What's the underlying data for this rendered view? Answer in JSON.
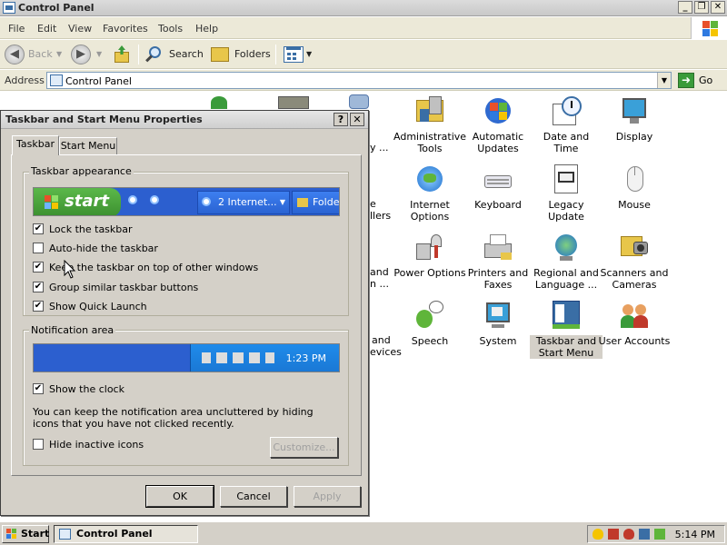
{
  "window": {
    "title": "Control Panel"
  },
  "menu": [
    "File",
    "Edit",
    "View",
    "Favorites",
    "Tools",
    "Help"
  ],
  "toolbar": {
    "back": "Back",
    "search": "Search",
    "folders": "Folders"
  },
  "address": {
    "label": "Address",
    "value": "Control Panel",
    "go": "Go"
  },
  "control_panel": {
    "items": [
      {
        "label": "Administrative Tools",
        "icon": "administrative-tools-icon"
      },
      {
        "label": "Automatic Updates",
        "icon": "automatic-updates-icon"
      },
      {
        "label": "Date and Time",
        "icon": "date-time-icon"
      },
      {
        "label": "Display",
        "icon": "display-icon"
      },
      {
        "label": "Internet Options",
        "icon": "internet-options-icon"
      },
      {
        "label": "Keyboard",
        "icon": "keyboard-icon"
      },
      {
        "label": "Legacy Update",
        "icon": "legacy-update-icon"
      },
      {
        "label": "Mouse",
        "icon": "mouse-icon"
      },
      {
        "label": "Power Options",
        "icon": "power-options-icon"
      },
      {
        "label": "Printers and Faxes",
        "icon": "printers-faxes-icon"
      },
      {
        "label": "Regional and Language ...",
        "icon": "regional-language-icon"
      },
      {
        "label": "Scanners and Cameras",
        "icon": "scanners-cameras-icon"
      },
      {
        "label": "Speech",
        "icon": "speech-icon"
      },
      {
        "label": "System",
        "icon": "system-icon"
      },
      {
        "label": "Taskbar and Start Menu",
        "icon": "taskbar-start-menu-icon"
      },
      {
        "label": "User Accounts",
        "icon": "user-accounts-icon"
      }
    ],
    "partial_labels": [
      "y ...",
      "e",
      "llers",
      "and",
      "n ...",
      "and",
      "evices"
    ]
  },
  "dialog": {
    "title": "Taskbar and Start Menu Properties",
    "help": "?",
    "close": "✕",
    "tabs": [
      "Taskbar",
      "Start Menu"
    ],
    "taskbar_appearance": {
      "label": "Taskbar appearance",
      "preview": {
        "start": "start",
        "window_button": "2 Internet...",
        "folder_button": "Folde"
      },
      "options": [
        {
          "label": "Lock the taskbar",
          "checked": true
        },
        {
          "label": "Auto-hide the taskbar",
          "checked": false
        },
        {
          "label": "Keep the taskbar on top of other windows",
          "checked": true
        },
        {
          "label": "Group similar taskbar buttons",
          "checked": true
        },
        {
          "label": "Show Quick Launch",
          "checked": true
        }
      ]
    },
    "notification_area": {
      "label": "Notification area",
      "preview_clock": "1:23 PM",
      "show_clock": {
        "label": "Show the clock",
        "checked": true
      },
      "description": "You can keep the notification area uncluttered by hiding icons that you have not clicked recently.",
      "hide_inactive": {
        "label": "Hide inactive icons",
        "checked": false
      },
      "customize": "Customize..."
    },
    "buttons": {
      "ok": "OK",
      "cancel": "Cancel",
      "apply": "Apply"
    }
  },
  "taskbar": {
    "start": "Start",
    "task": "Control Panel",
    "clock": "5:14 PM"
  },
  "colors": {
    "xp_blue": "#2c5fcf",
    "start_green": "#3c8f2f",
    "dialog_face": "#d4d0c8"
  }
}
